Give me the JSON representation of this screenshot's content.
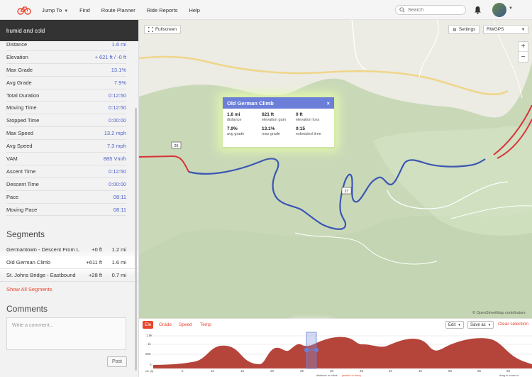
{
  "nav": {
    "items": [
      "Jump To",
      "Find",
      "Route Planner",
      "Ride Reports",
      "Help"
    ],
    "search_placeholder": "Search"
  },
  "sidebar": {
    "route_title": "humid and cold",
    "stats": [
      {
        "label": "Distance",
        "value": "1.6 mi"
      },
      {
        "label": "Elevation",
        "value": "+ 621 ft / -0 ft"
      },
      {
        "label": "Max Grade",
        "value": "13.1%"
      },
      {
        "label": "Avg Grade",
        "value": "7.9%"
      },
      {
        "label": "Total Duration",
        "value": "0:12:50"
      },
      {
        "label": "Moving Time",
        "value": "0:12:50"
      },
      {
        "label": "Stopped Time",
        "value": "0:00:00"
      },
      {
        "label": "Max Speed",
        "value": "13.2 mph"
      },
      {
        "label": "Avg Speed",
        "value": "7.3 mph"
      },
      {
        "label": "VAM",
        "value": "885 Vm/h"
      },
      {
        "label": "Ascent Time",
        "value": "0:12:50"
      },
      {
        "label": "Descent Time",
        "value": "0:00:00"
      },
      {
        "label": "Pace",
        "value": "08:11"
      },
      {
        "label": "Moving Pace",
        "value": "08:11"
      }
    ],
    "segments_heading": "Segments",
    "segments": [
      {
        "name": "Germantown - Descent From Leif ...",
        "gain": "+0 ft",
        "dist": "1.2 mi"
      },
      {
        "name": "Old German Climb",
        "gain": "+611 ft",
        "dist": "1.6 mi"
      },
      {
        "name": "St. Johns Bridge - Eastbound",
        "gain": "+28 ft",
        "dist": "0.7 mi"
      }
    ],
    "show_all": "Show All Segments",
    "comments_heading": "Comments",
    "comment_placeholder": "Write a comment...",
    "post_label": "Post"
  },
  "map": {
    "fullscreen_label": "Fullscreen",
    "settings_label": "Settings",
    "map_type": "RWGPS",
    "zoom_in": "+",
    "zoom_out": "−",
    "attribution": "© OpenStreetMap contributors",
    "road_labels": [
      "26",
      "27"
    ],
    "popup": {
      "title": "Old German Climb",
      "close": "×",
      "stats": [
        {
          "value": "1.6 mi",
          "label": "distance"
        },
        {
          "value": "621 ft",
          "label": "elevation gain"
        },
        {
          "value": "0 ft",
          "label": "elevation loss"
        },
        {
          "value": "7.9%",
          "label": "avg grade"
        },
        {
          "value": "13.1%",
          "label": "max grade"
        },
        {
          "value": "0:15",
          "label": "estimated time"
        }
      ]
    }
  },
  "elevation": {
    "tabs": [
      "Ele",
      "Grade",
      "Speed",
      "Temp"
    ],
    "active_tab": "Ele",
    "edit_label": "Edit",
    "save_label": "Save as",
    "clear_label": "Clear selection",
    "y_ticks": [
      "1.5k",
      "1k",
      "500",
      "0"
    ],
    "x_ticks": [
      "5",
      "10",
      "15",
      "20",
      "25",
      "30",
      "35",
      "40",
      "45",
      "50",
      "55",
      "60"
    ],
    "axis_unit_ele": "ele (ft)",
    "x_caption": "distance in miles",
    "x_caption_link": "(switch to time)",
    "right_caption": "drag to zoom in"
  },
  "colors": {
    "brand": "#e8452c",
    "accent": "#6c7fd8",
    "route": "#3b56b3",
    "elevation_fill": "#b5443a"
  }
}
